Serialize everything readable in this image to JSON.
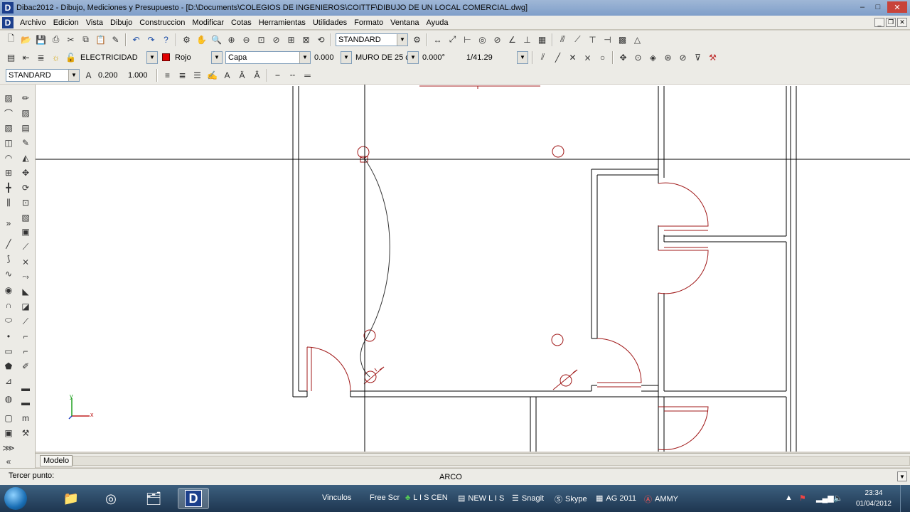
{
  "window": {
    "title": "Dibac2012 - Dibujo, Mediciones y Presupuesto - [D:\\Documents\\COLEGIOS DE INGENIEROS\\COITTF\\DIBUJO DE UN LOCAL COMERCIAL.dwg]",
    "min": "–",
    "max": "□",
    "close": "✕"
  },
  "menu": {
    "logo": "D",
    "items": [
      "Archivo",
      "Edicion",
      "Vista",
      "Dibujo",
      "Construccion",
      "Modificar",
      "Cotas",
      "Herramientas",
      "Utilidades",
      "Formato",
      "Ventana",
      "Ayuda"
    ]
  },
  "toolbar1": {
    "style_combo": "STANDARD"
  },
  "toolbar2": {
    "layer": "ELECTRICIDAD",
    "color": "Rojo",
    "color_hex": "#e00000",
    "linetype": "Capa",
    "lineweight": "0.000",
    "wall": "MURO DE 25 c",
    "angle": "0.000°",
    "scale": "1/41.29"
  },
  "toolbar3": {
    "text_style": "STANDARD",
    "height": "0.200",
    "width": "1.000"
  },
  "tabs": {
    "model": "Modelo"
  },
  "command": {
    "prompt": "Tercer punto:",
    "current": "ARCO"
  },
  "taskbar": {
    "items": [
      {
        "label": "Vinculos"
      },
      {
        "label": "Free Scr"
      },
      {
        "label": "L I S CEN"
      },
      {
        "label": "NEW L I S"
      },
      {
        "label": "Snagit"
      },
      {
        "label": "Skype"
      },
      {
        "label": "AG 2011"
      },
      {
        "label": "AMMY"
      }
    ],
    "time": "23:34",
    "date": "01/04/2012"
  },
  "colors": {
    "wall": "#000000",
    "door": "#a01818",
    "electric": "#a01818",
    "wire": "#333333"
  },
  "icons": [
    "new-icon",
    "open-icon",
    "save-icon",
    "print-icon",
    "cut-icon",
    "copy-icon",
    "paste-icon",
    "undo-icon",
    "redo-icon",
    "help-icon",
    "pan-icon",
    "zoom-icon",
    "line-icon",
    "circle-icon",
    "arc-icon",
    "wall-icon",
    "door-icon",
    "window-icon"
  ]
}
